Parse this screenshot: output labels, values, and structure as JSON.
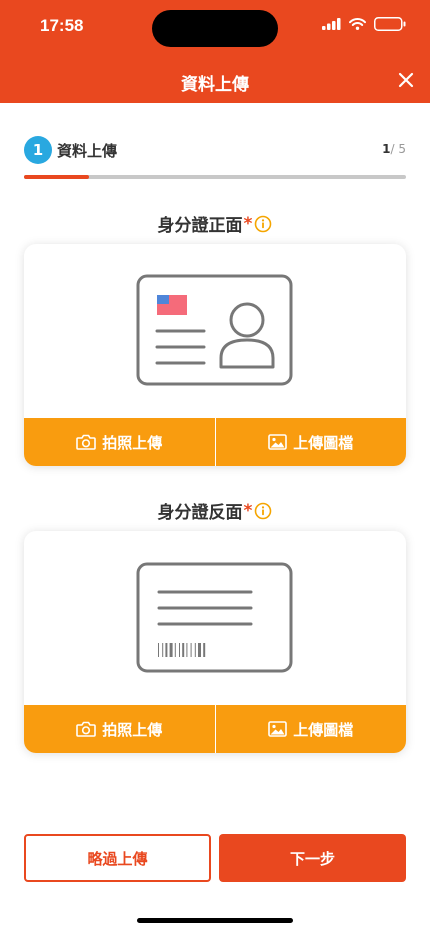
{
  "status_bar": {
    "time": "17:58"
  },
  "header": {
    "title": "資料上傳"
  },
  "step": {
    "number": "1",
    "label": "資料上傳",
    "current": "1",
    "separator": "/",
    "total": "5",
    "progress_fraction": 0.17
  },
  "front": {
    "title": "身分證正面",
    "required_mark": "*",
    "photo_label": "拍照上傳",
    "upload_label": "上傳圖檔"
  },
  "back": {
    "title": "身分證反面",
    "required_mark": "*",
    "photo_label": "拍照上傳",
    "upload_label": "上傳圖檔"
  },
  "footer": {
    "skip_label": "略過上傳",
    "next_label": "下一步"
  },
  "icons": {
    "close": "close-icon",
    "info": "info-icon",
    "camera": "camera-icon",
    "image": "image-icon"
  },
  "colors": {
    "brand": "#e9481f",
    "action": "#f99c0f",
    "step_badge": "#29a8e0",
    "info": "#f5a500"
  }
}
